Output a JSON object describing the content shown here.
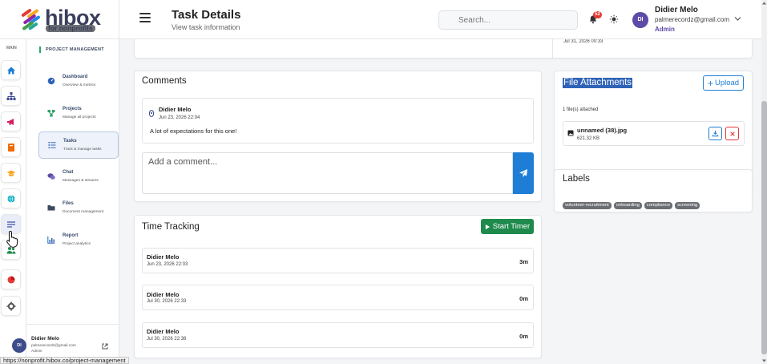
{
  "header": {
    "logo_text": "hibox",
    "logo_tagline": "for nonprofits",
    "title": "Task Details",
    "subtitle": "View task information",
    "search_placeholder": "Search...",
    "notification_count": "52",
    "user": {
      "initials": "DI",
      "name": "Didier Melo",
      "email": "palmerecordz@gmail.com",
      "role": "Admin"
    }
  },
  "rail": {
    "label": "MAIN",
    "icons": [
      "home-icon",
      "sitemap-icon",
      "megaphone-icon",
      "book-icon",
      "graduation-cap-icon",
      "globe-icon",
      "kanban-icon",
      "people-icon",
      "pie-chart-icon",
      "gear-icon"
    ]
  },
  "project_sidebar": {
    "section": "PROJECT MANAGEMENT",
    "items": [
      {
        "title": "Dashboard",
        "subtitle": "Overview & metrics",
        "icon": "gauge-icon",
        "color": "#2f63b8"
      },
      {
        "title": "Projects",
        "subtitle": "Manage all projects",
        "icon": "diagram-icon",
        "color": "#2ca36b"
      },
      {
        "title": "Tasks",
        "subtitle": "Track & manage tasks",
        "icon": "checklist-icon",
        "color": "#2f63b8"
      },
      {
        "title": "Chat",
        "subtitle": "Messages & streams",
        "icon": "chat-icon",
        "color": "#5e4ba8"
      },
      {
        "title": "Files",
        "subtitle": "Document management",
        "icon": "folder-icon",
        "color": "#3b4a5c"
      },
      {
        "title": "Report",
        "subtitle": "Project analytics",
        "icon": "bar-chart-icon",
        "color": "#2f63b8"
      }
    ],
    "footer": {
      "initials": "DI",
      "name": "Didier Melo",
      "email": "palmerecordz@gmail.com",
      "role": "Admin"
    }
  },
  "activity": {
    "timestamp": "Jul 31, 2026 00:33"
  },
  "comments": {
    "title": "Comments",
    "items": [
      {
        "author": "Didier Melo",
        "date": "Jun 23, 2026 22:04",
        "text": "A lot of expectations for this one!"
      }
    ],
    "input_placeholder": "Add a comment..."
  },
  "time_tracking": {
    "title": "Time Tracking",
    "start_label": "Start Timer",
    "entries": [
      {
        "user": "Didier Melo",
        "date": "Jun 23, 2026 22:03",
        "duration": "3m"
      },
      {
        "user": "Didier Melo",
        "date": "Jul 30, 2026 22:33",
        "duration": "0m"
      },
      {
        "user": "Didier Melo",
        "date": "Jul 30, 2026 22:38",
        "duration": "0m"
      }
    ]
  },
  "attachments": {
    "title": "File Attachments",
    "upload_label": "Upload",
    "count_text": "1 file(s) attached",
    "files": [
      {
        "name": "unnamed (38).jpg",
        "size": "621.32 KB"
      }
    ]
  },
  "labels": {
    "title": "Labels",
    "tags": [
      "volunteer-recruitment",
      "onboarding",
      "compliance",
      "screening"
    ]
  },
  "status_bar": {
    "url": "https://nonprofit.hibox.co/project-management"
  },
  "colors": {
    "primary": "#1e7ed6",
    "success": "#1e8a4c",
    "danger": "#e53935",
    "selection": "#2f63b8"
  }
}
